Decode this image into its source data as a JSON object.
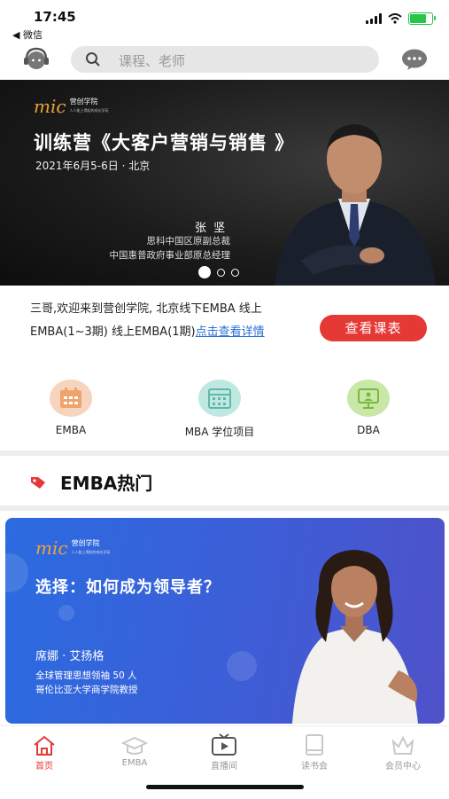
{
  "status": {
    "time": "17:45",
    "back_app": "◀ 微信"
  },
  "header": {
    "search_placeholder": "课程、老师"
  },
  "banner": {
    "brand": "营创学院",
    "brand_sub": "人人能上得起的成长学苑",
    "title": "训练营《大客户营销与销售 》",
    "date_place": "2021年6月5-6日 · 北京",
    "speaker": "张 坚",
    "role1": "思科中国区原副总裁",
    "role2": "中国惠普政府事业部原总经理",
    "slide_count": 3,
    "active_slide": 1
  },
  "notice": {
    "text": "三哥,欢迎来到营创学院, 北京线下EMBA 线上EMBA(1~3期) 线上EMBA(1期)",
    "link": "点击查看详情",
    "button": "查看课表"
  },
  "categories": [
    {
      "label": "EMBA",
      "icon": "calendar-icon",
      "color": "#f7d4bd",
      "icon_color": "#f0a36b"
    },
    {
      "label": "MBA 学位项目",
      "icon": "grid-calendar-icon",
      "color": "#bfe8e1",
      "icon_color": "#5fb8a8"
    },
    {
      "label": "DBA",
      "icon": "presentation-icon",
      "color": "#c9e7a6",
      "icon_color": "#7ab83f"
    }
  ],
  "section": {
    "title": "EMBA热门"
  },
  "course_card": {
    "brand": "营创学院",
    "brand_sub": "人人能上得起的成长学苑",
    "title": "选择：如何成为领导者？",
    "teacher": "席娜 · 艾扬格",
    "desc1": "全球管理思想领袖 50 人",
    "desc2": "哥伦比亚大学商学院教授"
  },
  "tabbar": [
    {
      "label": "首页",
      "icon": "home-icon",
      "active": true
    },
    {
      "label": "EMBA",
      "icon": "graduation-cap-icon",
      "active": false
    },
    {
      "label": "直播间",
      "icon": "tv-icon",
      "active": false
    },
    {
      "label": "读书会",
      "icon": "book-icon",
      "active": false
    },
    {
      "label": "会员中心",
      "icon": "crown-icon",
      "active": false
    }
  ],
  "colors": {
    "accent": "#e53935",
    "link": "#2a6fd6",
    "card_blue": "#2b6be0"
  }
}
